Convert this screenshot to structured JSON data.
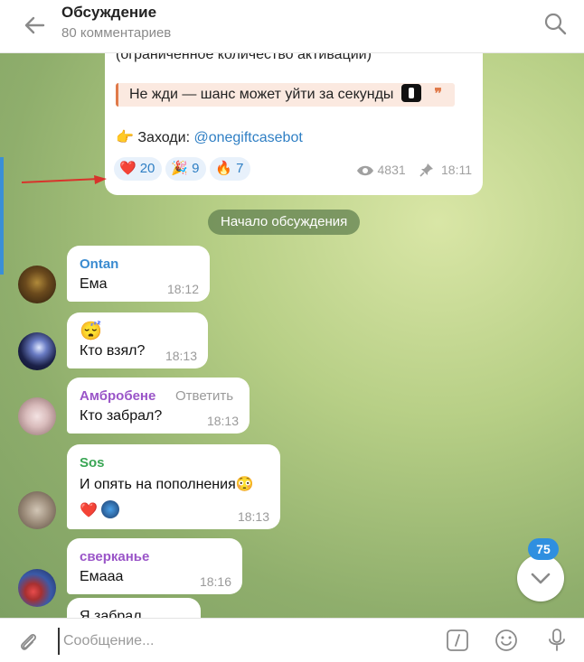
{
  "header": {
    "title": "Обсуждение",
    "subtitle": "80 комментариев"
  },
  "post": {
    "line1": "(ограниченное количество активаций)",
    "quote": "Не жди — шанс может уйти за секунды",
    "quote_mark": "❞",
    "visit_prefix": "Заходи: ",
    "visit_link": "@onegiftcasebot",
    "reactions": [
      {
        "emoji": "❤️",
        "count": "20"
      },
      {
        "emoji": "🎉",
        "count": "9"
      },
      {
        "emoji": "🔥",
        "count": "7"
      }
    ],
    "views": "4831",
    "time": "18:11"
  },
  "divider": "Начало обсуждения",
  "messages": [
    {
      "author": "Ontan",
      "text": "Ема",
      "time": "18:12",
      "author_color": "#3a8bd0"
    },
    {
      "author": "",
      "emoji": "😴",
      "text": "Кто взял?",
      "time": "18:13"
    },
    {
      "author": "Амбробене",
      "reply": "Ответить",
      "text": "Кто забрал?",
      "time": "18:13",
      "author_color": "#9a55c8"
    },
    {
      "author": "Sos",
      "text": "И опять на пополнения😳",
      "time": "18:13",
      "author_color": "#3aa655"
    },
    {
      "author": "сверканье",
      "text": "Емааа",
      "time": "18:16",
      "author_color": "#9a55c8"
    },
    {
      "author": "",
      "text": "Я забрал",
      "time": ""
    }
  ],
  "scroll": {
    "badge": "75"
  },
  "input": {
    "placeholder": "Сообщение..."
  }
}
